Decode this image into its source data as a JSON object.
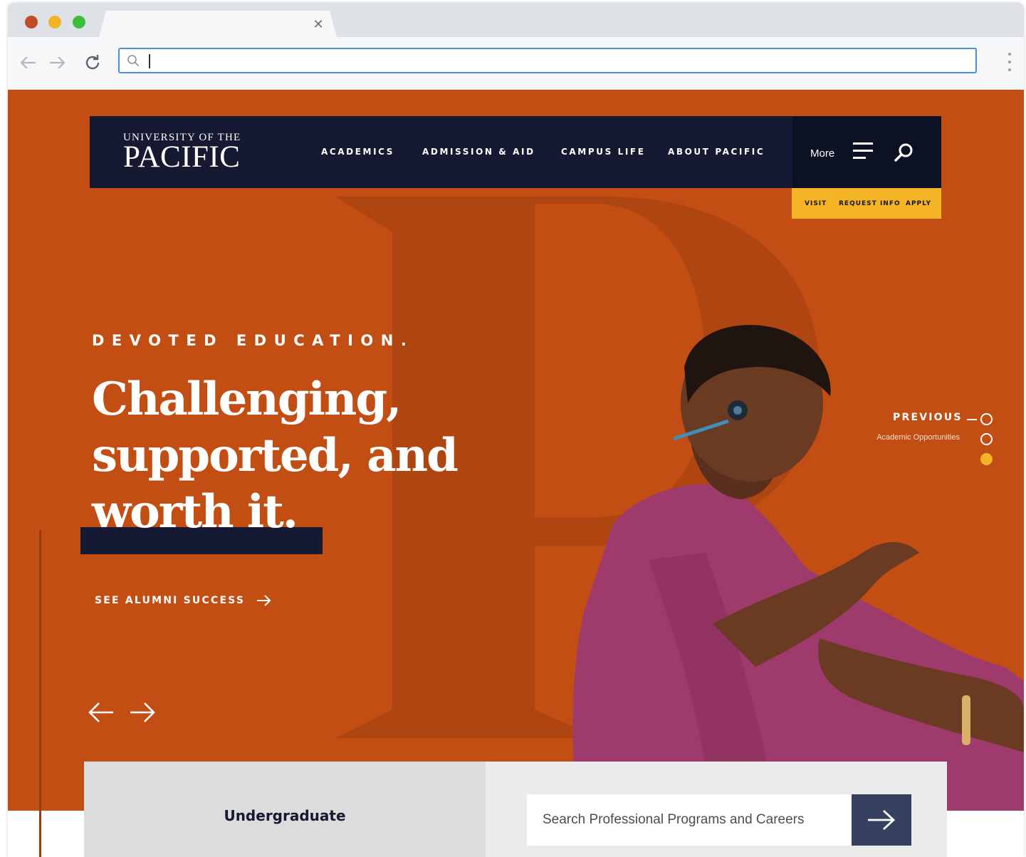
{
  "browser": {
    "tab": {
      "title": "",
      "close_icon": "close-icon"
    },
    "address_bar": {
      "value": "",
      "placeholder": ""
    },
    "icons": {
      "back": "arrow-left-icon",
      "forward": "arrow-right-icon",
      "reload": "reload-icon",
      "search": "search-icon",
      "menu": "kebab-menu-icon"
    },
    "traffic_lights": {
      "close": "#bf4d26",
      "minimize": "#f2b327",
      "zoom": "#3ebd3a"
    }
  },
  "site": {
    "logo": {
      "line1": "UNIVERSITY OF THE",
      "line2": "PACIFIC"
    },
    "nav": {
      "items": [
        {
          "label": "ACADEMICS"
        },
        {
          "label": "ADMISSION & AID"
        },
        {
          "label": "CAMPUS LIFE"
        },
        {
          "label": "ABOUT PACIFIC"
        }
      ],
      "more_label": "More",
      "menu_icon": "hamburger-icon",
      "search_icon": "search-icon"
    },
    "cta_bar": {
      "visit": "VISIT",
      "request_info": "REQUEST INFO",
      "apply": "APPLY"
    },
    "hero": {
      "eyebrow": "DEVOTED EDUCATION.",
      "headline_lines": [
        "Challenging,",
        "supported, and",
        "worth it."
      ],
      "cta": "SEE ALUMNI SUCCESS",
      "cta_icon": "arrow-right-icon",
      "prev_arrow_icon": "arrow-left-icon",
      "next_arrow_icon": "arrow-right-icon"
    },
    "slide_nav": {
      "previous_label": "PREVIOUS",
      "caption": "Academic Opportunities",
      "active_index": 3,
      "total": 3
    },
    "program_search": {
      "tab_label": "Undergraduate",
      "placeholder": "Search Professional Programs and Careers",
      "value": "",
      "submit_icon": "arrow-right-icon"
    },
    "colors": {
      "hero_orange": "#c24e14",
      "navy": "#151931",
      "gold": "#f4b324",
      "button_slate": "#36405f"
    }
  }
}
